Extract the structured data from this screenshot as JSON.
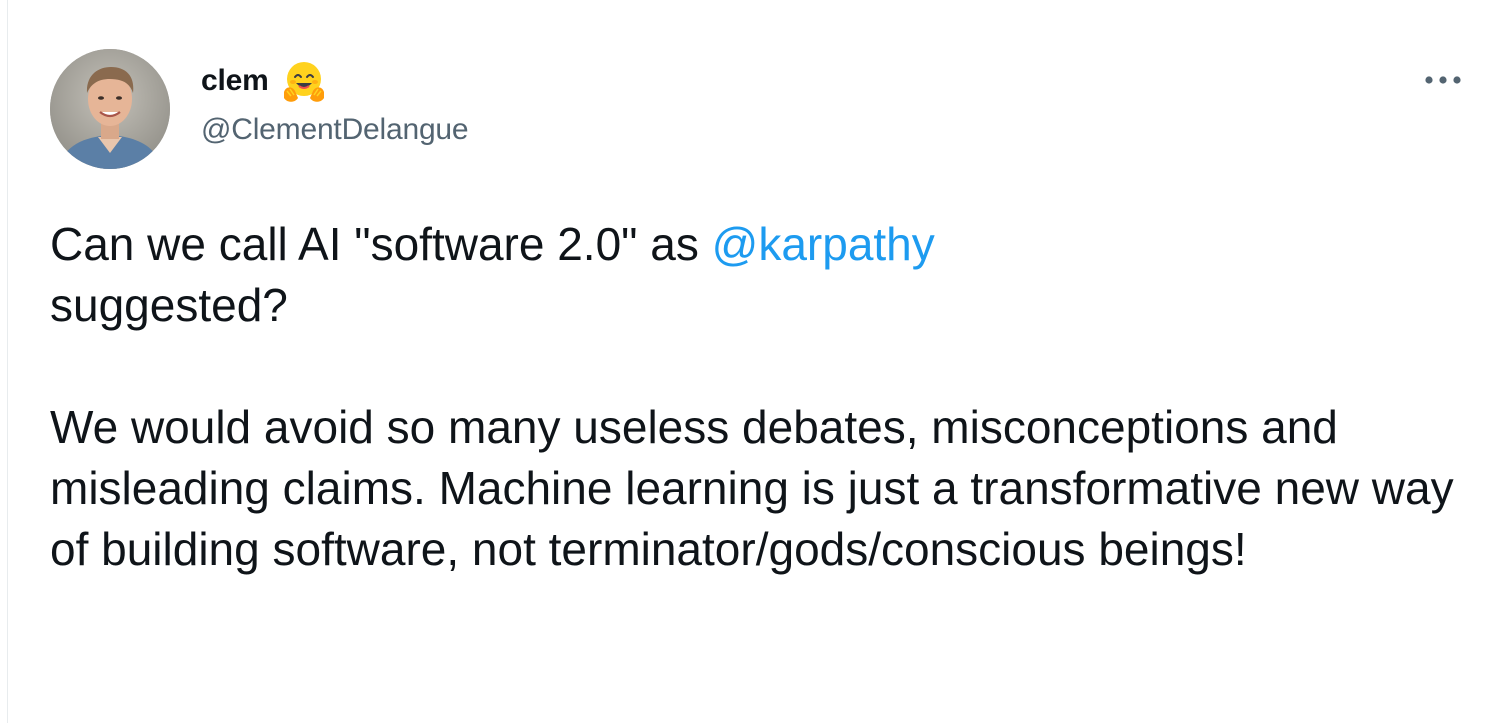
{
  "author": {
    "display_name": "clem",
    "emoji": "hugging-face-emoji",
    "handle": "@ClementDelangue",
    "avatar": "profile-photo"
  },
  "actions": {
    "more_icon": "more-horizontal-icon"
  },
  "tweet": {
    "line1_prefix": "Can we call AI \"software 2.0\" as ",
    "mention": "@karpathy",
    "line1_suffix": " suggested?",
    "paragraph2": "We would avoid so many useless debates, misconceptions and misleading claims. Machine learning is just a transformative new way of building software, not terminator/gods/conscious beings!"
  },
  "colors": {
    "text_primary": "#0f1419",
    "text_secondary": "#536471",
    "link": "#1d9bf0",
    "emoji_yellow": "#ffd21e",
    "emoji_orange": "#ff9d0b"
  }
}
